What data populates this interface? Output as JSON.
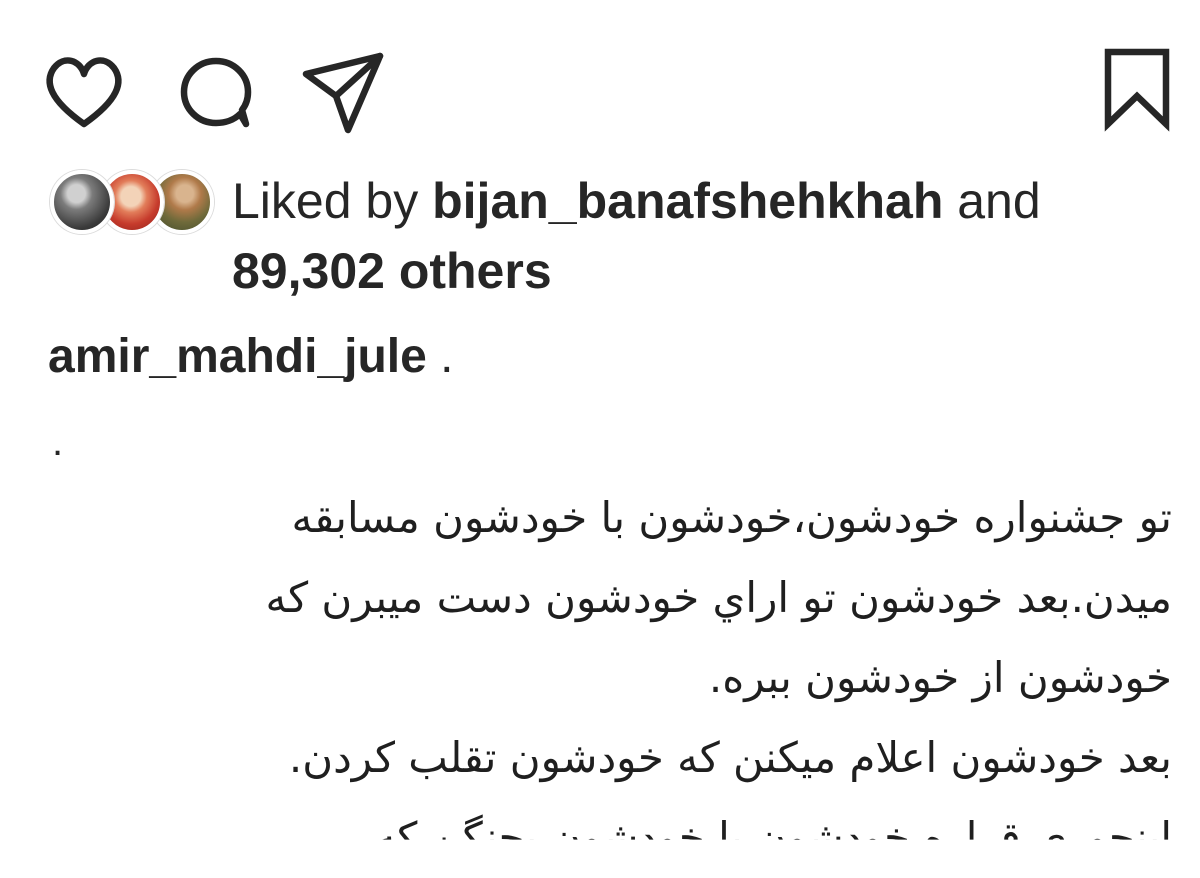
{
  "actions": {
    "like_icon": "heart-icon",
    "comment_icon": "comment-icon",
    "share_icon": "paper-plane-icon",
    "save_icon": "bookmark-icon"
  },
  "likes": {
    "prefix": "Liked by ",
    "username": "bijan_banafshehkhah",
    "conjunction": " and",
    "count_text": "89,302 others"
  },
  "caption": {
    "username": "amir_mahdi_jule",
    "separator": " .",
    "dot_line": ".",
    "lines": [
      "تو جشنواره خودشون،خودشون با خودشون مسابقه",
      "میدن.بعد خودشون تو اراي خودشون دست میبرن که",
      "خودشون از خودشون ببره.",
      "بعد خودشون اعلام میکنن که خودشون تقلب کردن.",
      "اینجوری قراره خودشون با خودشون بجنگن که"
    ]
  },
  "colors": {
    "text": "#262626",
    "background": "#ffffff"
  }
}
